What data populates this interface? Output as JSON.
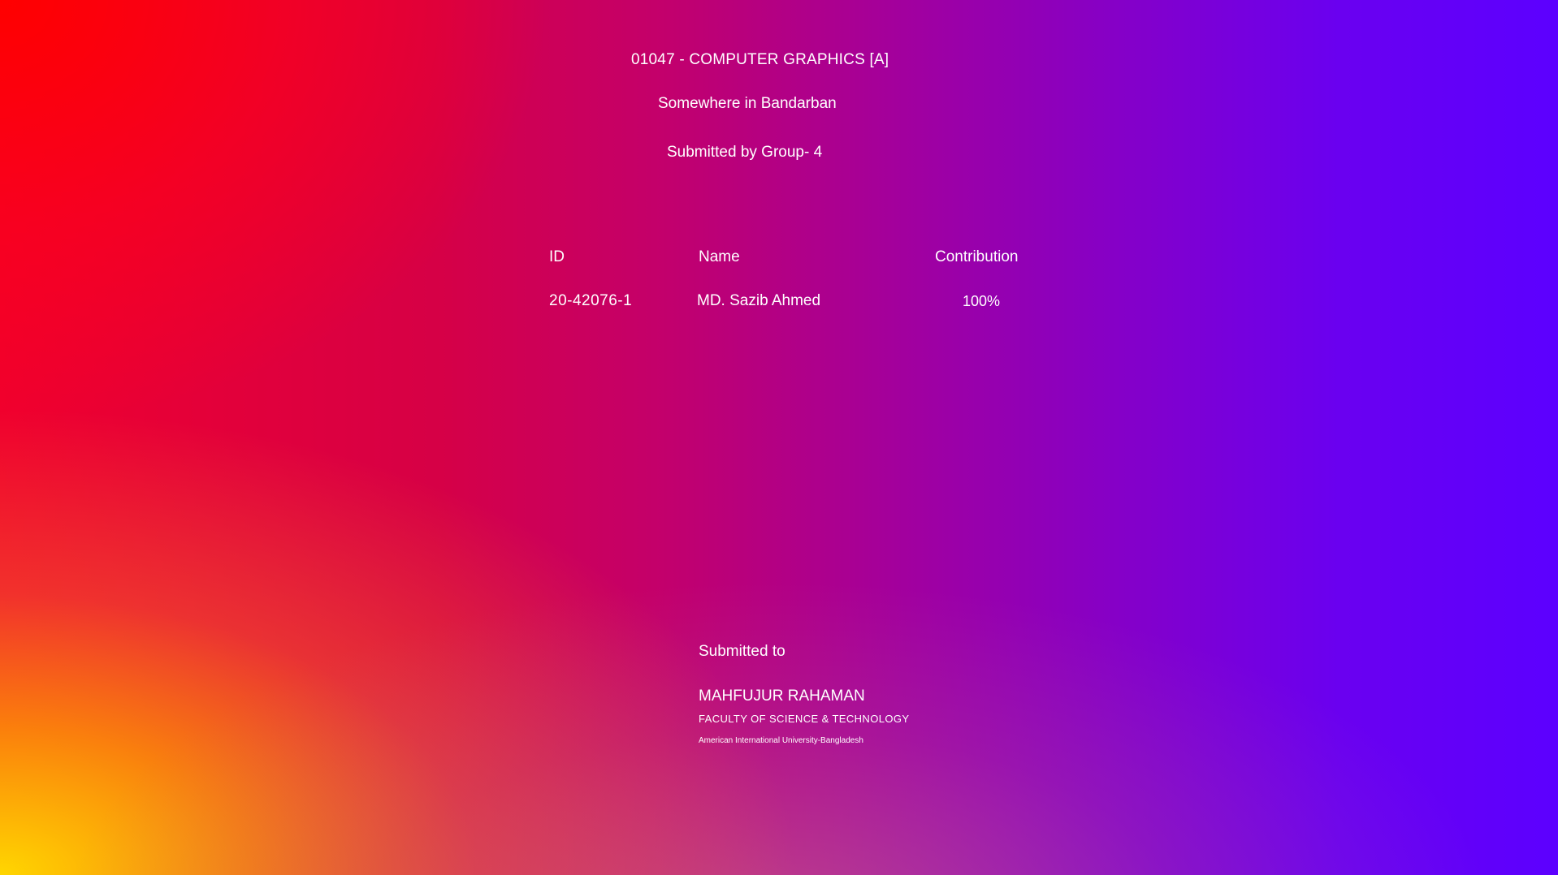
{
  "title": {
    "course": "01047 - COMPUTER GRAPHICS [A]",
    "project": "Somewhere in Bandarban",
    "group": "Submitted by Group- 4"
  },
  "table": {
    "headers": [
      "ID",
      "Name",
      "Contribution"
    ],
    "rows": [
      [
        "20-42076-1",
        "MD. Sazib Ahmed",
        "100%"
      ]
    ]
  },
  "submitted_to": {
    "label": "Submitted to",
    "name": "MAHFUJUR RAHAMAN",
    "faculty": "FACULTY OF SCIENCE & TECHNOLOGY",
    "university": "American International University-Bangladesh"
  },
  "colors": {
    "top_left": "#ff0000",
    "bottom_left": "#ffd400",
    "right": "#5c00ff",
    "text": "#ffffff"
  }
}
